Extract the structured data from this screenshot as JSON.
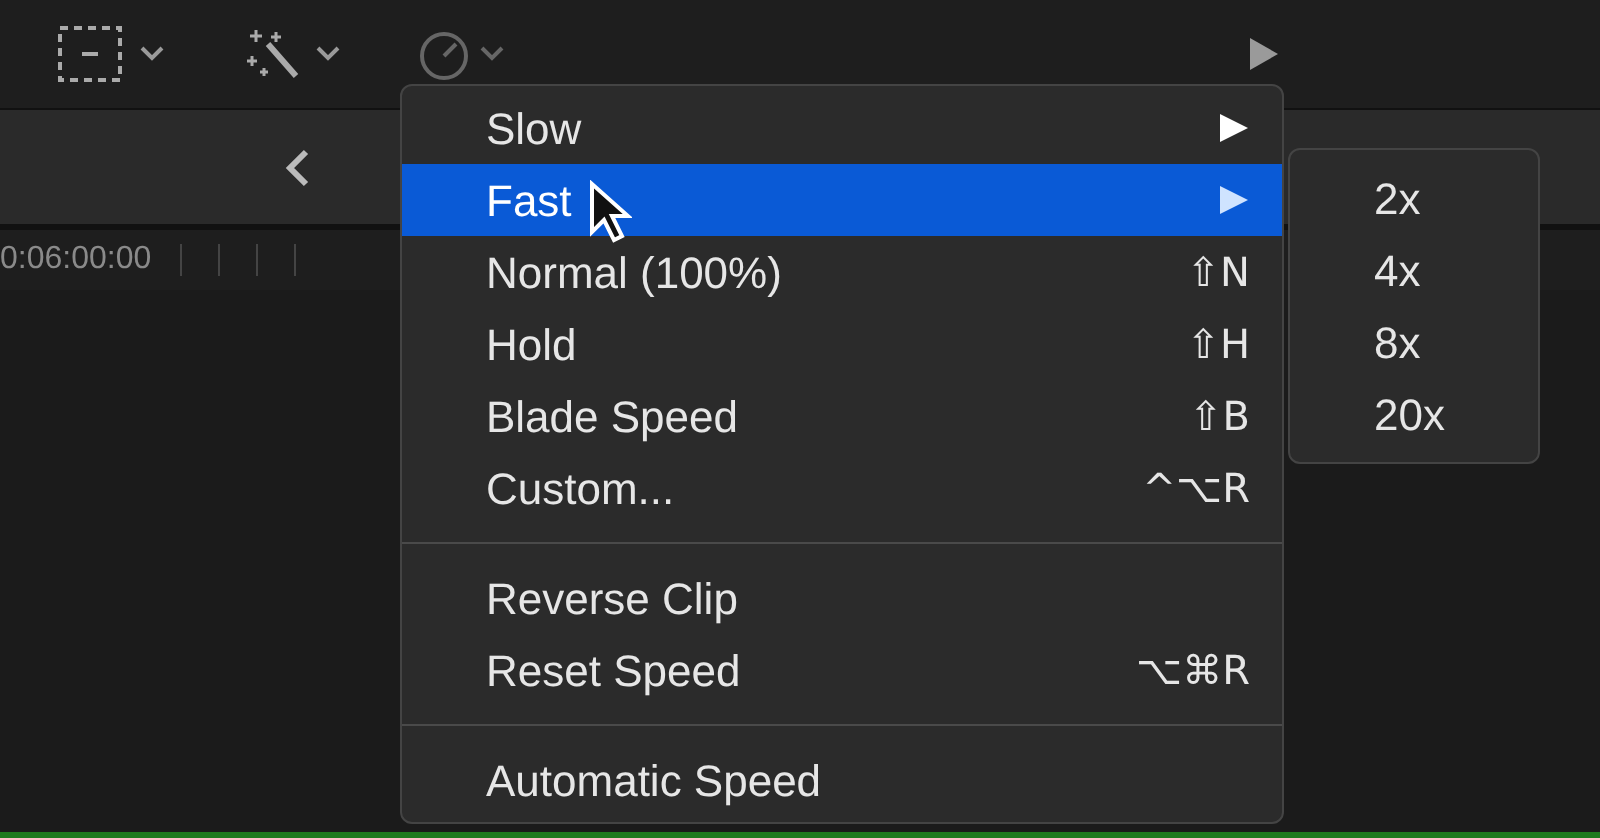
{
  "ruler": {
    "timecode": "0:06:00:00"
  },
  "menu": {
    "sections": [
      [
        {
          "label": "Slow",
          "kind": "submenu",
          "selected": false
        },
        {
          "label": "Fast",
          "kind": "submenu",
          "selected": true
        },
        {
          "label": "Normal (100%)",
          "kind": "command",
          "shortcut": "⇧N",
          "selected": false
        },
        {
          "label": "Hold",
          "kind": "command",
          "shortcut": "⇧H",
          "selected": false
        },
        {
          "label": "Blade Speed",
          "kind": "command",
          "shortcut": "⇧B",
          "selected": false
        },
        {
          "label": "Custom...",
          "kind": "command",
          "shortcut": "^⌥R",
          "selected": false
        }
      ],
      [
        {
          "label": "Reverse Clip",
          "kind": "command",
          "selected": false
        },
        {
          "label": "Reset Speed",
          "kind": "command",
          "shortcut": "⌥⌘R",
          "selected": false
        }
      ],
      [
        {
          "label": "Automatic Speed",
          "kind": "command",
          "selected": false
        }
      ]
    ]
  },
  "submenu": {
    "items": [
      "2x",
      "4x",
      "8x",
      "20x"
    ]
  }
}
